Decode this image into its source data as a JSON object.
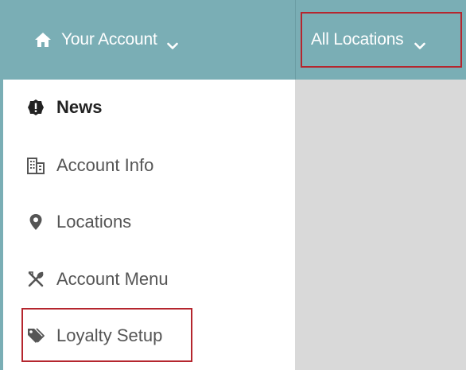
{
  "header": {
    "account_label": "Your Account",
    "location_label": "All Locations",
    "colors": {
      "bar": "#7aaeb5",
      "highlight": "#b5262e"
    }
  },
  "sidebar": {
    "items": [
      {
        "label": "News",
        "icon": "exclamation-badge-icon",
        "active": true
      },
      {
        "label": "Account Info",
        "icon": "building-icon",
        "active": false
      },
      {
        "label": "Locations",
        "icon": "map-marker-icon",
        "active": false
      },
      {
        "label": "Account Menu",
        "icon": "utensils-icon",
        "active": false
      },
      {
        "label": "Loyalty Setup",
        "icon": "tags-icon",
        "active": false
      }
    ]
  }
}
